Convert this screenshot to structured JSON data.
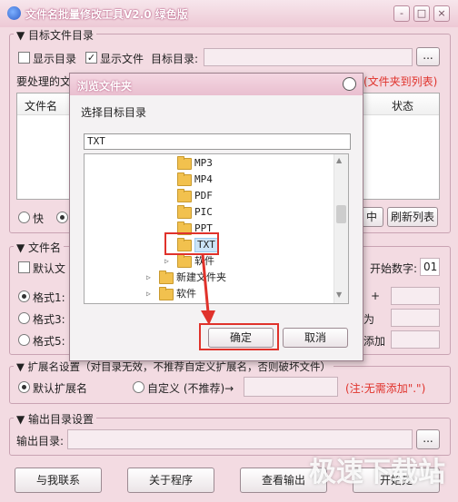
{
  "window": {
    "title": "文件名批量修改工具V2.0  绿色版",
    "minimize": "-",
    "maximize": "□",
    "close": "×"
  },
  "target_group": {
    "title": "目标文件目录",
    "show_dirs": "显示目录",
    "show_files": "显示文件",
    "dir_label": "目标目录:",
    "dir_value": "",
    "browse": "...",
    "list_label": "要处理的文",
    "hint": "(文件夹到列表)",
    "col_name": "文件名",
    "col_status": "状态",
    "radio_fast": "快",
    "btn_partial": "中",
    "btn_refresh": "刷新列表"
  },
  "name_group": {
    "title": "文件名",
    "default_label": "默认文",
    "start_num_label": "开始数字:",
    "start_num_value": "01",
    "format1": "格式1:",
    "format3": "格式3:",
    "format5": "格式5:",
    "right1": "+",
    "right2": "为",
    "right3": "添加"
  },
  "ext_group": {
    "title": "扩展名设置（对目录无效，不推荐自定义扩展名，否则破坏文件）",
    "default_ext": "默认扩展名",
    "custom_ext": "自定义 (不推荐)→",
    "note": "(注:无需添加\".\")"
  },
  "output_group": {
    "title": "输出目录设置",
    "label": "输出目录:",
    "value": "",
    "browse": "..."
  },
  "bottom_buttons": {
    "contact": "与我联系",
    "about": "关于程序",
    "view_output": "查看输出",
    "start": "开始处"
  },
  "watermark": "极速下载站",
  "dialog": {
    "title": "浏览文件夹",
    "prompt": "选择目标目录",
    "path_value": "TXT",
    "tree": [
      {
        "name": "MP3",
        "level": 1
      },
      {
        "name": "MP4",
        "level": 1
      },
      {
        "name": "PDF",
        "level": 1
      },
      {
        "name": "PIC",
        "level": 1
      },
      {
        "name": "PPT",
        "level": 1
      },
      {
        "name": "TXT",
        "level": 1,
        "selected": true
      },
      {
        "name": "软件",
        "level": 1,
        "expandable": true
      },
      {
        "name": "新建文件夹",
        "level": 0,
        "expandable": true
      },
      {
        "name": "软件",
        "level": 0,
        "expandable": true
      }
    ],
    "ok": "确定",
    "cancel": "取消"
  },
  "colors": {
    "accent_red": "#e0322b",
    "bg": "#f3dbe2"
  }
}
